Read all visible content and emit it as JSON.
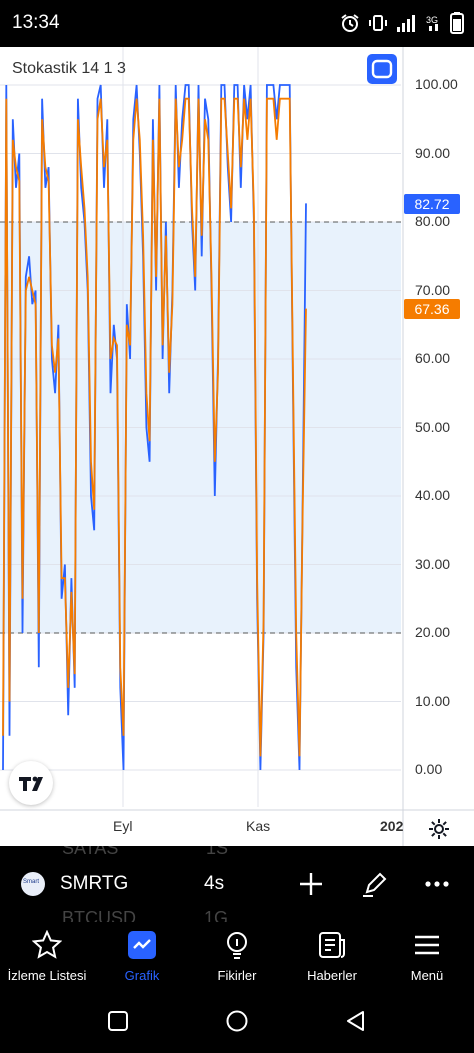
{
  "status": {
    "time": "13:34"
  },
  "chart": {
    "title": "Stokastik 14 1 3",
    "y_ticks": [
      "100.00",
      "90.00",
      "80.00",
      "70.00",
      "60.00",
      "50.00",
      "40.00",
      "30.00",
      "20.00",
      "10.00",
      "0.00"
    ],
    "x_ticks": [
      "Eyl",
      "Kas",
      "202"
    ],
    "badges": {
      "blue": "82.72",
      "orange": "67.36"
    },
    "colors": {
      "blue": "#2962ff",
      "orange": "#f57c00",
      "band": "#e8f2fc"
    }
  },
  "chart_data": {
    "type": "line",
    "title": "Stokastik 14 1 3",
    "ylim": [
      0,
      100
    ],
    "x_tick_labels": [
      "Eyl",
      "Kas",
      "202"
    ],
    "bands": {
      "upper": 80,
      "lower": 20
    },
    "last_values": {
      "%K": 82.72,
      "%D": 67.36
    },
    "series": [
      {
        "values": [
          0,
          100,
          5,
          95,
          85,
          90,
          20,
          72,
          75,
          68,
          70,
          15,
          98,
          85,
          88,
          60,
          55,
          65,
          25,
          30,
          8,
          28,
          12,
          98,
          85,
          80,
          70,
          40,
          35,
          98,
          100,
          85,
          95,
          55,
          65,
          60,
          12,
          0,
          68,
          60,
          95,
          100,
          90,
          75,
          50,
          45,
          95,
          70,
          100,
          60,
          80,
          55,
          70,
          100,
          85,
          95,
          100,
          100,
          80,
          70,
          100,
          75,
          98,
          95,
          70,
          40,
          60,
          100,
          100,
          88,
          80,
          100,
          100,
          85,
          100,
          95,
          100,
          80,
          25,
          0,
          20,
          100,
          100,
          100,
          95,
          100,
          100,
          100,
          100,
          55,
          15,
          0,
          40,
          82.72
        ]
      },
      {
        "values": [
          5,
          98,
          10,
          92,
          88,
          86,
          25,
          70,
          72,
          70,
          68,
          20,
          95,
          88,
          86,
          62,
          58,
          63,
          28,
          28,
          12,
          26,
          14,
          95,
          88,
          82,
          72,
          45,
          38,
          95,
          98,
          88,
          92,
          60,
          63,
          62,
          15,
          5,
          65,
          62,
          92,
          98,
          92,
          78,
          55,
          48,
          92,
          72,
          98,
          62,
          78,
          58,
          68,
          98,
          88,
          92,
          98,
          98,
          82,
          72,
          98,
          78,
          95,
          92,
          72,
          45,
          58,
          98,
          98,
          90,
          82,
          98,
          98,
          88,
          98,
          92,
          98,
          82,
          28,
          2,
          22,
          98,
          98,
          98,
          92,
          98,
          98,
          98,
          98,
          58,
          20,
          2,
          38,
          67.36
        ]
      }
    ]
  },
  "symbol_bar": {
    "symbol": "SMRTG",
    "interval": "4s",
    "logo_text": "Smart",
    "ghost_top_left": "SATAS",
    "ghost_top_right": "1S",
    "ghost_bottom_left": "BTCUSD",
    "ghost_bottom_right": "1G"
  },
  "tabs": [
    {
      "label": "İzleme Listesi"
    },
    {
      "label": "Grafik"
    },
    {
      "label": "Fikirler"
    },
    {
      "label": "Haberler"
    },
    {
      "label": "Menü"
    }
  ]
}
